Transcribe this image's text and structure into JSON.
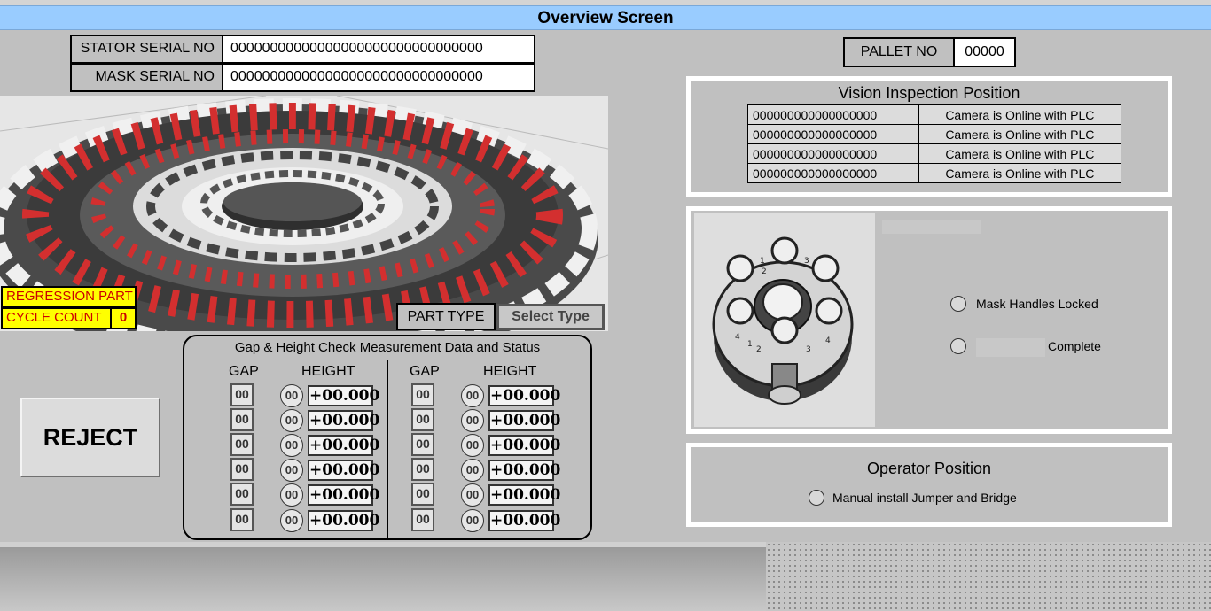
{
  "title": "Overview Screen",
  "stator": {
    "label": "STATOR SERIAL NO",
    "value": "00000000000000000000000000000000"
  },
  "mask": {
    "label": "MASK SERIAL NO",
    "value": "00000000000000000000000000000000"
  },
  "pallet": {
    "label": "PALLET NO",
    "value": "00000"
  },
  "regression_label": "REGRESSION PART",
  "cycle_count": {
    "label": "CYCLE COUNT",
    "value": "0"
  },
  "part_type": {
    "label": "PART TYPE",
    "select": "Select Type"
  },
  "vision": {
    "title": "Vision Inspection Position",
    "rows": [
      {
        "serial": "000000000000000000",
        "status": "Camera is Online with PLC"
      },
      {
        "serial": "000000000000000000",
        "status": "Camera is Online with PLC"
      },
      {
        "serial": "000000000000000000",
        "status": "Camera is Online with PLC"
      },
      {
        "serial": "000000000000000000",
        "status": "Camera is Online with PLC"
      }
    ]
  },
  "mask_status": {
    "locked": "Mask Handles Locked",
    "complete": "Complete"
  },
  "operator": {
    "title": "Operator Position",
    "task": "Manual install Jumper and Bridge"
  },
  "reject": "REJECT",
  "gap_height": {
    "title": "Gap & Height Check Measurement Data and Status",
    "gap_label": "GAP",
    "height_label": "HEIGHT",
    "left": [
      {
        "gap": "00",
        "id": "00",
        "height": "+00.000"
      },
      {
        "gap": "00",
        "id": "00",
        "height": "+00.000"
      },
      {
        "gap": "00",
        "id": "00",
        "height": "+00.000"
      },
      {
        "gap": "00",
        "id": "00",
        "height": "+00.000"
      },
      {
        "gap": "00",
        "id": "00",
        "height": "+00.000"
      },
      {
        "gap": "00",
        "id": "00",
        "height": "+00.000"
      }
    ],
    "right": [
      {
        "gap": "00",
        "id": "00",
        "height": "+00.000"
      },
      {
        "gap": "00",
        "id": "00",
        "height": "+00.000"
      },
      {
        "gap": "00",
        "id": "00",
        "height": "+00.000"
      },
      {
        "gap": "00",
        "id": "00",
        "height": "+00.000"
      },
      {
        "gap": "00",
        "id": "00",
        "height": "+00.000"
      },
      {
        "gap": "00",
        "id": "00",
        "height": "+00.000"
      }
    ]
  },
  "fixture_numbers": [
    "1",
    "2",
    "3",
    "4",
    "1",
    "2",
    "3",
    "4"
  ],
  "colors": {
    "title_bg": "#99ccff",
    "alert_bg": "#ffff00",
    "alert_text": "#cc0000",
    "panel_border": "#ffffff"
  }
}
